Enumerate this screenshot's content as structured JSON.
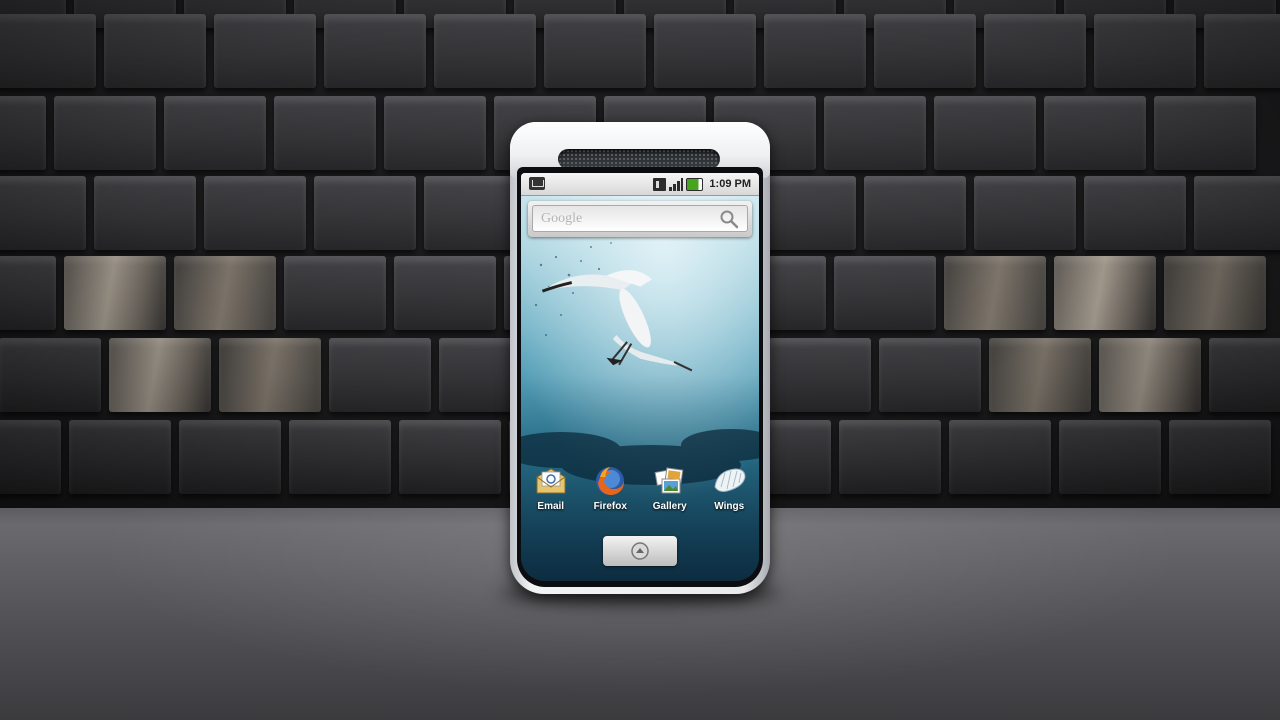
{
  "status_bar": {
    "time": "1:09 PM",
    "icons": [
      "notification-icon",
      "data-icon",
      "signal-icon",
      "battery-icon"
    ]
  },
  "search": {
    "placeholder": "Google",
    "icon": "search-icon"
  },
  "apps": [
    {
      "label": "Email",
      "icon": "email-icon"
    },
    {
      "label": "Firefox",
      "icon": "firefox-icon"
    },
    {
      "label": "Gallery",
      "icon": "gallery-icon"
    },
    {
      "label": "Wings",
      "icon": "wings-icon"
    }
  ],
  "launcher": {
    "icon": "launcher-icon"
  },
  "colors": {
    "battery": "#46a41f",
    "firefox_orange": "#e8661b",
    "firefox_blue": "#2a5ca8"
  }
}
